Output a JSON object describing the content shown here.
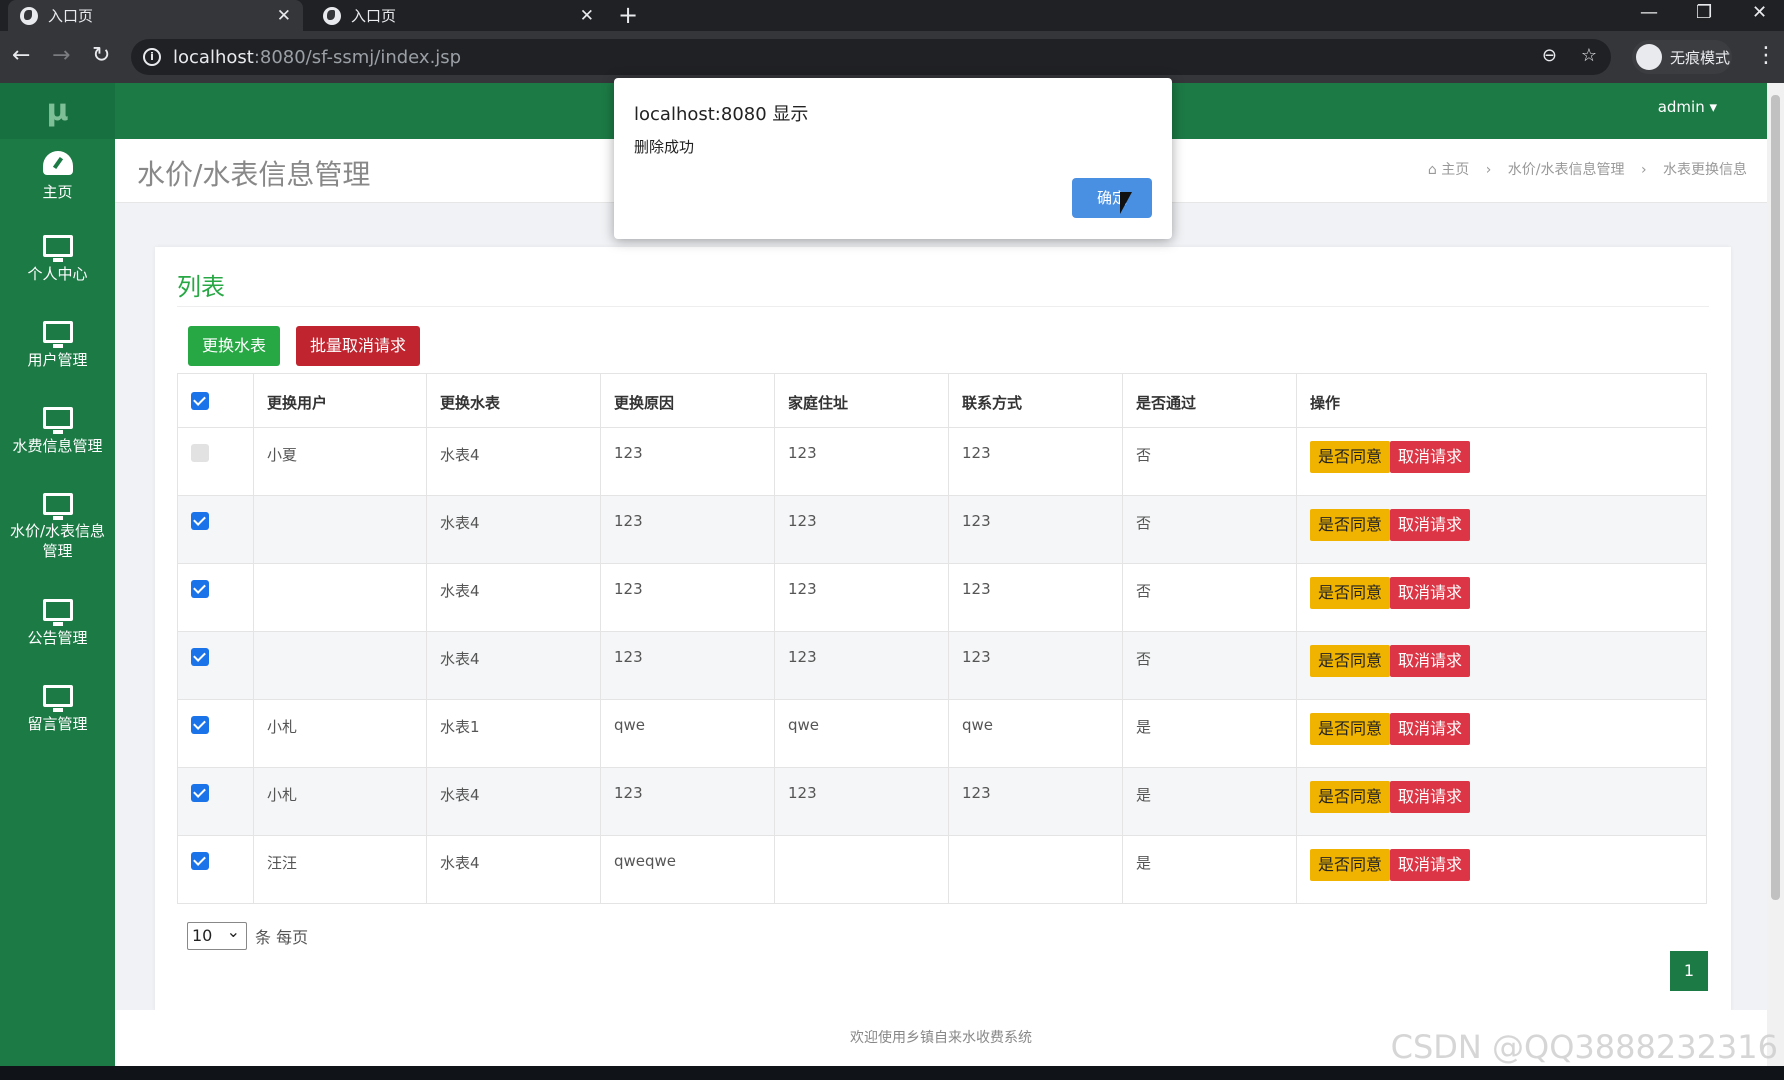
{
  "browser": {
    "tabs": [
      {
        "label": "入口页",
        "active": true
      },
      {
        "label": "入口页",
        "active": false
      }
    ],
    "new_tab": "+",
    "url_host": "localhost",
    "url_rest": ":8080/sf-ssmj/index.jsp",
    "incognito_label": "无痕模式"
  },
  "brand": "μ",
  "user_menu": "admin ▾",
  "sidebar": {
    "items": [
      {
        "label": "主页",
        "icon": "dashboard-icon"
      },
      {
        "label": "个人中心",
        "icon": "monitor-icon"
      },
      {
        "label": "用户管理",
        "icon": "monitor-icon"
      },
      {
        "label": "水费信息管理",
        "icon": "monitor-icon"
      },
      {
        "label_line1": "水价/水表信息",
        "label_line2": "管理",
        "icon": "monitor-icon"
      },
      {
        "label": "公告管理",
        "icon": "monitor-icon"
      },
      {
        "label": "留言管理",
        "icon": "monitor-icon"
      }
    ]
  },
  "page": {
    "title": "水价/水表信息管理",
    "breadcrumb": [
      "主页",
      "水价/水表信息管理",
      "水表更换信息"
    ]
  },
  "card": {
    "title": "列表",
    "buttons": {
      "change_meter": "更换水表",
      "batch_cancel": "批量取消请求"
    },
    "columns": [
      "更换用户",
      "更换水表",
      "更换原因",
      "家庭住址",
      "联系方式",
      "是否通过",
      "操作"
    ],
    "rows": [
      {
        "checked": false,
        "user": "小夏",
        "meter": "水表4",
        "reason": "123",
        "address": "123",
        "contact": "123",
        "passed": "否"
      },
      {
        "checked": true,
        "user": "",
        "meter": "水表4",
        "reason": "123",
        "address": "123",
        "contact": "123",
        "passed": "否"
      },
      {
        "checked": true,
        "user": "",
        "meter": "水表4",
        "reason": "123",
        "address": "123",
        "contact": "123",
        "passed": "否"
      },
      {
        "checked": true,
        "user": "",
        "meter": "水表4",
        "reason": "123",
        "address": "123",
        "contact": "123",
        "passed": "否"
      },
      {
        "checked": true,
        "user": "小札",
        "meter": "水表1",
        "reason": "qwe",
        "address": "qwe",
        "contact": "qwe",
        "passed": "是"
      },
      {
        "checked": true,
        "user": "小札",
        "meter": "水表4",
        "reason": "123",
        "address": "123",
        "contact": "123",
        "passed": "是"
      },
      {
        "checked": true,
        "user": "汪汪",
        "meter": "水表4",
        "reason": "qweqwe",
        "address": "",
        "contact": "",
        "passed": "是"
      }
    ],
    "row_actions": {
      "approve": "是否同意",
      "cancel": "取消请求"
    },
    "page_size": "10",
    "page_size_suffix": "条 每页",
    "current_page": "1"
  },
  "footer": "欢迎使用乡镇自来水收费系统",
  "dialog": {
    "title": "localhost:8080 显示",
    "message": "删除成功",
    "ok": "确定"
  },
  "watermark": "CSDN @QQ3888232316",
  "colors": {
    "primary_green": "#1c7a45",
    "accent_green": "#28a745",
    "danger_red": "#dc3545",
    "warning_yellow": "#f0b400",
    "dialog_blue": "#4a90e2"
  }
}
